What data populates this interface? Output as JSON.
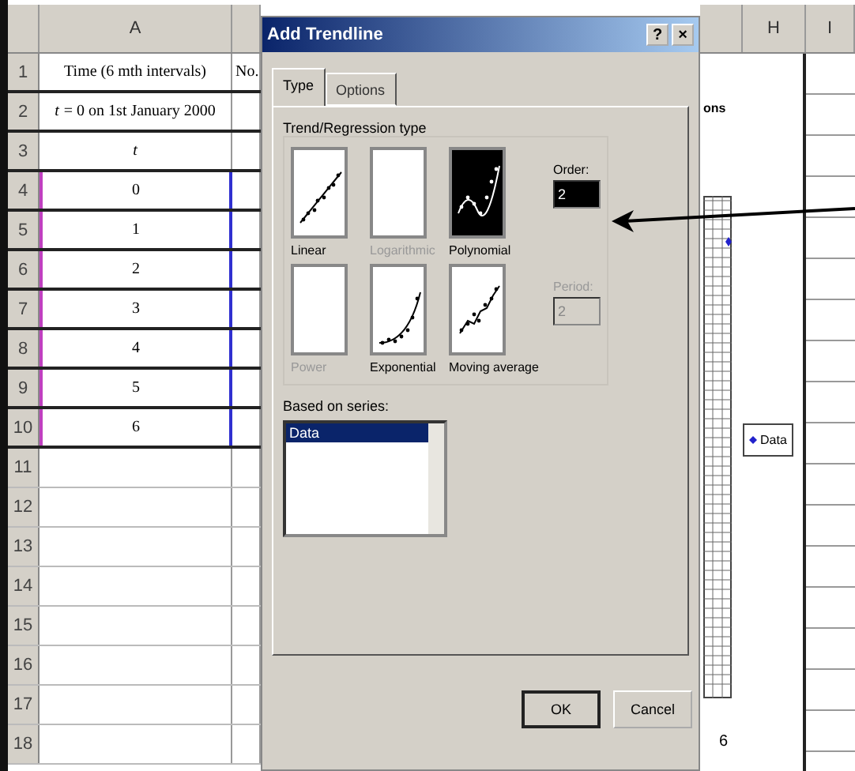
{
  "sheet": {
    "column_header": "A",
    "rows": [
      {
        "number": "1",
        "selected": false,
        "cells": [
          {
            "text": "Time (6 mth intervals)",
            "italic": false
          },
          {
            "text": "No.",
            "italic": false
          }
        ]
      },
      {
        "number": "2",
        "selected": false,
        "cells": [
          {
            "text": "*t* = 0 on 1st January 2000",
            "italic": false
          }
        ]
      },
      {
        "number": "3",
        "selected": false,
        "cells": [
          {
            "text": "t",
            "italic": true
          }
        ]
      },
      {
        "number": "4",
        "selected": true,
        "cells": [
          {
            "text": "0",
            "italic": false
          }
        ]
      },
      {
        "number": "5",
        "selected": true,
        "cells": [
          {
            "text": "1",
            "italic": false
          }
        ]
      },
      {
        "number": "6",
        "selected": true,
        "cells": [
          {
            "text": "2",
            "italic": false
          }
        ]
      },
      {
        "number": "7",
        "selected": true,
        "cells": [
          {
            "text": "3",
            "italic": false
          }
        ]
      },
      {
        "number": "8",
        "selected": true,
        "cells": [
          {
            "text": "4",
            "italic": false
          }
        ]
      },
      {
        "number": "9",
        "selected": true,
        "cells": [
          {
            "text": "5",
            "italic": false
          }
        ]
      },
      {
        "number": "10",
        "selected": true,
        "cells": [
          {
            "text": "6",
            "italic": false
          }
        ]
      },
      {
        "number": "11",
        "selected": false,
        "cells": []
      },
      {
        "number": "12",
        "selected": false,
        "cells": []
      },
      {
        "number": "13",
        "selected": false,
        "cells": []
      },
      {
        "number": "14",
        "selected": false,
        "cells": []
      },
      {
        "number": "15",
        "selected": false,
        "cells": []
      },
      {
        "number": "16",
        "selected": false,
        "cells": []
      },
      {
        "number": "17",
        "selected": false,
        "cells": []
      },
      {
        "number": "18",
        "selected": false,
        "cells": []
      }
    ]
  },
  "dialog": {
    "title": "Add Trendline",
    "help_button": "?",
    "close_button": "×",
    "tabs": [
      {
        "label": "Type",
        "selected": true
      },
      {
        "label": "Options",
        "selected": false
      }
    ],
    "group_label": "Trend/Regression type",
    "types": [
      {
        "kind": "linear",
        "label": "Linear",
        "selected": false,
        "disabled": false
      },
      {
        "kind": "logarithmic",
        "label": "Logarithmic",
        "selected": false,
        "disabled": true
      },
      {
        "kind": "polynomial",
        "label": "Polynomial",
        "selected": true,
        "disabled": false
      },
      {
        "kind": "power",
        "label": "Power",
        "selected": false,
        "disabled": true
      },
      {
        "kind": "exponential",
        "label": "Exponential",
        "selected": false,
        "disabled": false
      },
      {
        "kind": "moving_average",
        "label": "Moving average",
        "selected": false,
        "disabled": false
      }
    ],
    "order": {
      "label": "Order:",
      "value": "2",
      "disabled": false
    },
    "period": {
      "label": "Period:",
      "value": "2",
      "disabled": true
    },
    "series_label": "Based on series:",
    "series": [
      {
        "label": "Data",
        "selected": true
      }
    ],
    "buttons": [
      {
        "label": "OK",
        "default": true
      },
      {
        "label": "Cancel",
        "default": false
      }
    ]
  },
  "right": {
    "column_headers": [
      "H",
      "I"
    ],
    "chart": {
      "title_fragment": "ons",
      "axis_label": "6",
      "legend": "Data"
    }
  }
}
